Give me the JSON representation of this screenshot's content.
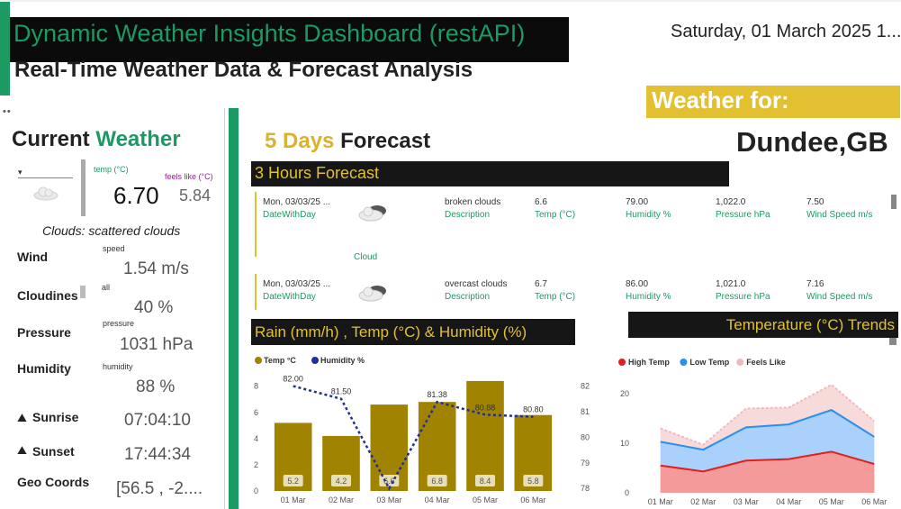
{
  "header": {
    "title": "Dynamic Weather Insights Dashboard (restAPI)",
    "subtitle": "Real-Time Weather Data & Forecast Analysis",
    "datetime": "Saturday, 01 March 2025 1...",
    "weather_for_label": "Weather for:",
    "location": "Dundee,GB"
  },
  "current": {
    "heading_1": "Current",
    "heading_2": "Weather",
    "slicer_value": "▾",
    "temp_label": "temp (°C)",
    "feels_label": "feels like (°C)",
    "temp": "6.70",
    "feels_like": "5.84",
    "clouds_text": "Clouds: scattered clouds",
    "rows": [
      {
        "label": "Wind",
        "sub": "speed",
        "value": "1.54 m/s"
      },
      {
        "label": "Cloudines",
        "sub": "all",
        "value": "40 %"
      },
      {
        "label": "Pressure",
        "sub": "pressure",
        "value": "1031 hPa"
      },
      {
        "label": "Humidity",
        "sub": "humidity",
        "value": "88 %"
      },
      {
        "label": "Sunrise",
        "sub": "",
        "value": "07:04:10"
      },
      {
        "label": "Sunset",
        "sub": "",
        "value": "17:44:34"
      },
      {
        "label": "Geo Coords",
        "sub": "",
        "value": "[56.5 , -2...."
      }
    ]
  },
  "forecast": {
    "heading_1": "5 Days",
    "heading_2": "Forecast",
    "section_title": "3 Hours Forecast",
    "cloud_label": "Cloud",
    "field_labels": {
      "date": "DateWithDay",
      "description": "Description",
      "temp": "Temp (°C)",
      "humidity": "Humidity %",
      "pressure": "Pressure hPa",
      "wind": "Wind Speed m/s"
    },
    "rows": [
      {
        "date": "Mon, 03/03/25 ...",
        "description": "broken clouds",
        "temp": "6.6",
        "humidity": "79.00",
        "pressure": "1,022.0",
        "wind": "7.50",
        "icon": "cloud-icon"
      },
      {
        "date": "Mon, 03/03/25 ...",
        "description": "overcast clouds",
        "temp": "6.7",
        "humidity": "86.00",
        "pressure": "1,021.0",
        "wind": "7.16",
        "icon": "cloud-icon"
      }
    ]
  },
  "rain_chart_title": "Rain (mm/h) , Temp (°C) & Humidity (%)",
  "temp_chart_title": "Temperature (°C) Trends",
  "chart_data": [
    {
      "type": "bar",
      "title": "Rain (mm/h) , Temp (°C) & Humidity (%)",
      "categories": [
        "01 Mar",
        "02 Mar",
        "03 Mar",
        "04 Mar",
        "05 Mar",
        "06 Mar"
      ],
      "series": [
        {
          "name": "Temp °C",
          "type": "bar",
          "values": [
            5.2,
            4.2,
            6.6,
            6.8,
            8.4,
            5.8
          ],
          "color": "#a08300"
        },
        {
          "name": "Humidity %",
          "type": "line",
          "values": [
            82.0,
            81.5,
            78.0,
            81.38,
            80.88,
            80.8
          ],
          "color": "#1f2f9a"
        }
      ],
      "bar_labels": [
        "5.2",
        "4.2",
        "6.6",
        "6.8",
        "8.4",
        "5.8"
      ],
      "line_labels": [
        "82.00",
        "81.50",
        "",
        "81.38",
        "80.88",
        "80.80"
      ],
      "y_left_ticks": [
        "0",
        "2",
        "4",
        "6",
        "8"
      ],
      "y_right_ticks": [
        "78",
        "79",
        "80",
        "81",
        "82"
      ],
      "ylim": [
        0,
        8.6
      ],
      "y2lim": [
        77.9,
        82.3
      ],
      "legend_position": "top-left",
      "grid": false
    },
    {
      "type": "area",
      "title": "Temperature (°C) Trends",
      "categories": [
        "01 Mar",
        "02 Mar",
        "03 Mar",
        "04 Mar",
        "05 Mar",
        "06 Mar"
      ],
      "series": [
        {
          "name": "High Temp",
          "values": [
            5.5,
            4.3,
            6.5,
            6.8,
            8.3,
            5.8
          ],
          "color": "#e01f1f"
        },
        {
          "name": "Low Temp",
          "values": [
            10.3,
            8.7,
            13.2,
            13.8,
            16.7,
            11.3
          ],
          "color": "#2b8ef0"
        },
        {
          "name": "Feels Like",
          "values": [
            13.0,
            9.7,
            17.0,
            17.2,
            21.8,
            14.5
          ],
          "color": "#f0b9c0"
        }
      ],
      "y_ticks": [
        "0",
        "10",
        "20"
      ],
      "ylim": [
        0,
        24
      ],
      "legend_position": "top-left",
      "grid": false
    }
  ]
}
